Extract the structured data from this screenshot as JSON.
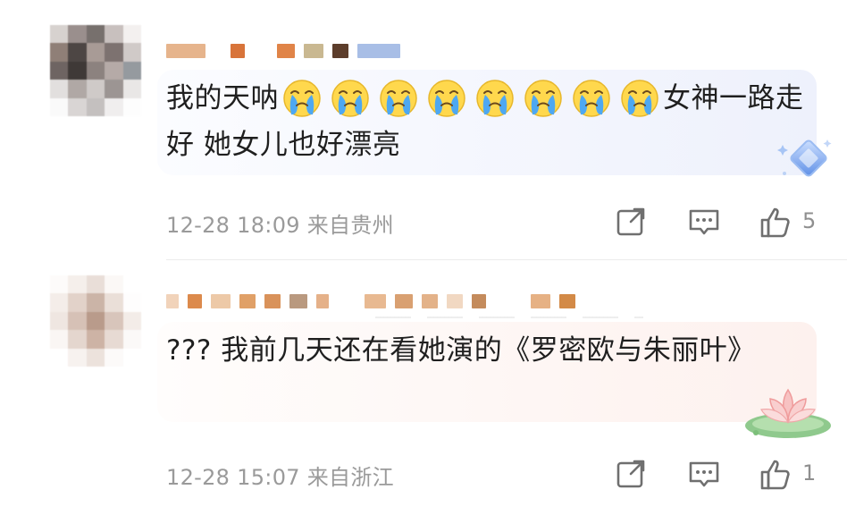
{
  "comments": [
    {
      "text_before": "我的天呐",
      "emoji_count": 8,
      "emoji_name": "crying-face",
      "text_after": "女神一路走好 她女儿也好漂亮",
      "time": "12-28 18:09",
      "location": "来自贵州",
      "likes": "5",
      "badge": "blue-diamond-icon"
    },
    {
      "text": "??? 我前几天还在看她演的《罗密欧与朱丽叶》",
      "time": "12-28 15:07",
      "location": "来自浙江",
      "likes": "1",
      "badge": "lotus-icon"
    }
  ],
  "meta": {
    "c1": "12-28 18:09  来自贵州",
    "c2": "12-28 15:07  来自浙江"
  },
  "colors": {
    "text": "#1f1f1f",
    "meta": "#9a9a9a",
    "bubble_blue": "#eef1fc",
    "bubble_pink": "#fdf1ee",
    "badge_blue": "#7da7f0",
    "lotus_pink": "#f4a0a0",
    "lotus_green": "#8fc98d"
  },
  "icons": {
    "share": "share-icon",
    "reply": "comment-icon",
    "like": "thumbs-up-icon"
  }
}
